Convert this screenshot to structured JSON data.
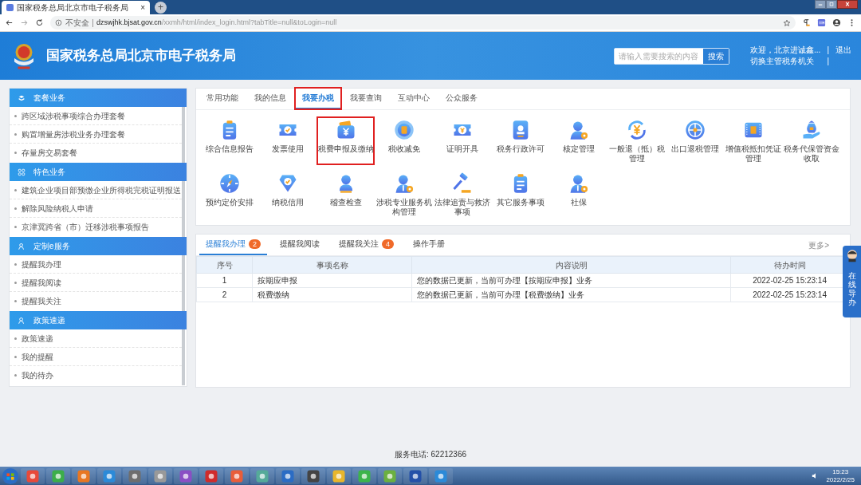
{
  "browser": {
    "tab_title": "国家税务总局北京市电子税务局",
    "tab_close": "×",
    "new_tab": "+",
    "security": "不安全",
    "url_host": "dzswjhk.bjsat.gov.cn",
    "url_path": "/xxmh/html/index_login.html?tabTitle=null&toLogin=null"
  },
  "header": {
    "title": "国家税务总局北京市电子税务局",
    "search": {
      "placeholder": "请输入需要搜索的内容",
      "button": "搜索"
    },
    "welcome": "欢迎，北京进诚鑫...",
    "separator_1": "|",
    "logout": "退出",
    "switch_office": "切换主管税务机关",
    "separator_2": "|"
  },
  "sidebar": [
    {
      "title": "套餐业务",
      "items": [
        "跨区域涉税事项综合办理套餐",
        "购置增量房涉税业务办理套餐",
        "存量房交易套餐"
      ]
    },
    {
      "title": "特色业务",
      "items": [
        "建筑企业项目部预缴企业所得税完税证明报送",
        "解除风险纳税人申请",
        "京津冀跨省（市）迁移涉税事项报告"
      ]
    },
    {
      "title": "定制e服务",
      "items": [
        "提醒我办理",
        "提醒我阅读",
        "提醒我关注"
      ]
    },
    {
      "title": "政策速递",
      "items": [
        "政策速递",
        "我的提醒",
        "我的待办"
      ]
    }
  ],
  "function_tabs": [
    {
      "label": "常用功能",
      "selected": false,
      "highlighted": false
    },
    {
      "label": "我的信息",
      "selected": false,
      "highlighted": false
    },
    {
      "label": "我要办税",
      "selected": true,
      "highlighted": true
    },
    {
      "label": "我要查询",
      "selected": false,
      "highlighted": false
    },
    {
      "label": "互动中心",
      "selected": false,
      "highlighted": false
    },
    {
      "label": "公众服务",
      "selected": false,
      "highlighted": false
    }
  ],
  "functions": [
    {
      "label": "综合信息报告",
      "highlighted": false
    },
    {
      "label": "发票使用",
      "highlighted": false
    },
    {
      "label": "税费申报及缴纳",
      "highlighted": true
    },
    {
      "label": "税收减免",
      "highlighted": false
    },
    {
      "label": "证明开具",
      "highlighted": false
    },
    {
      "label": "税务行政许可",
      "highlighted": false
    },
    {
      "label": "核定管理",
      "highlighted": false
    },
    {
      "label": "一般退（抵）税管理",
      "highlighted": false
    },
    {
      "label": "出口退税管理",
      "highlighted": false
    },
    {
      "label": "增值税抵扣凭证管理",
      "highlighted": false
    },
    {
      "label": "税务代保管资金收取",
      "highlighted": false
    },
    {
      "label": "预约定价安排",
      "highlighted": false
    },
    {
      "label": "纳税信用",
      "highlighted": false
    },
    {
      "label": "稽查检查",
      "highlighted": false
    },
    {
      "label": "涉税专业服务机构管理",
      "highlighted": false
    },
    {
      "label": "法律追责与救济事项",
      "highlighted": false
    },
    {
      "label": "其它服务事项",
      "highlighted": false
    },
    {
      "label": "社保",
      "highlighted": false
    }
  ],
  "reminders": {
    "tabs": [
      {
        "label": "提醒我办理",
        "badge": "2",
        "selected": true
      },
      {
        "label": "提醒我阅读",
        "selected": false
      },
      {
        "label": "提醒我关注",
        "badge": "4",
        "selected": false
      },
      {
        "label": "操作手册",
        "selected": false
      }
    ],
    "more": "更多>",
    "table": {
      "columns": [
        "序号",
        "事项名称",
        "内容说明",
        "待办时间"
      ],
      "rows": [
        [
          "1",
          "按期应申报",
          "您的数据已更新，当前可办理【按期应申报】业务",
          "2022-02-25 15:23:14"
        ],
        [
          "2",
          "税费缴纳",
          "您的数据已更新，当前可办理【税费缴纳】业务",
          "2022-02-25 15:23:14"
        ]
      ]
    }
  },
  "online_guide": "在线导办",
  "footer": "服务电话: 62212366",
  "taskbar": {
    "time": "15:23",
    "date": "2022/2/25"
  }
}
